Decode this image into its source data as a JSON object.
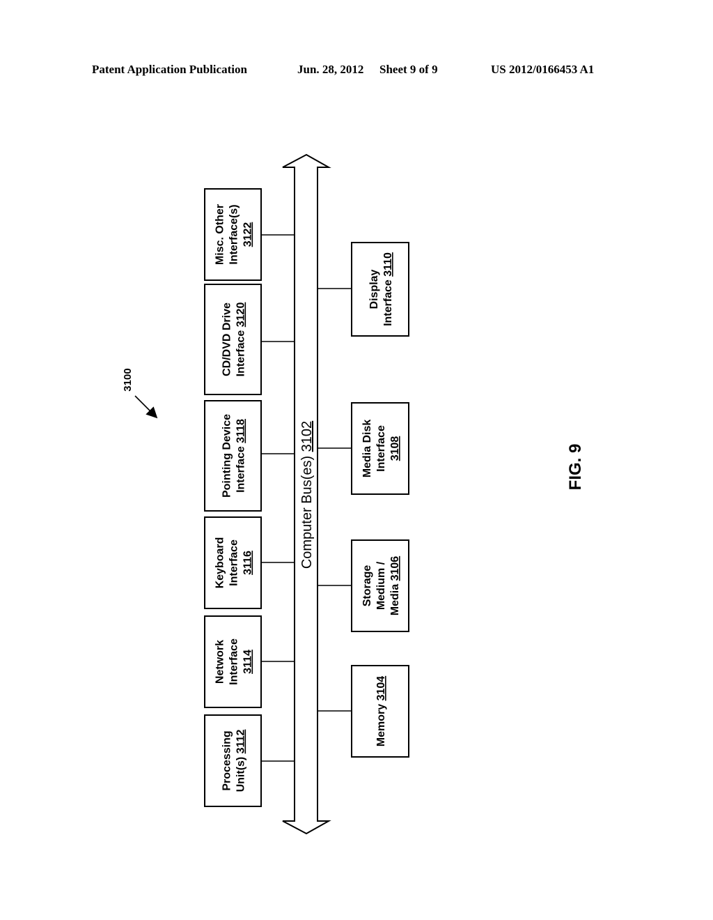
{
  "header": {
    "publication_type": "Patent Application Publication",
    "date": "Jun. 28, 2012",
    "sheet": "Sheet 9 of 9",
    "publication_number": "US 2012/0166453 A1"
  },
  "figure": {
    "label": "FIG. 9",
    "system_ref": "3100",
    "bus": {
      "text": "Computer Bus(es) ",
      "ref": "3102"
    },
    "upper_components": [
      {
        "lines": [
          {
            "text": "Processing",
            "ref": ""
          },
          {
            "text": "Unit(s) ",
            "ref": "3112"
          }
        ]
      },
      {
        "lines": [
          {
            "text": "Network",
            "ref": ""
          },
          {
            "text": "Interface",
            "ref": ""
          },
          {
            "text": "",
            "ref": "3114"
          }
        ]
      },
      {
        "lines": [
          {
            "text": "Keyboard",
            "ref": ""
          },
          {
            "text": "Interface",
            "ref": ""
          },
          {
            "text": "",
            "ref": "3116"
          }
        ]
      },
      {
        "lines": [
          {
            "text": "Pointing Device",
            "ref": ""
          },
          {
            "text": "Interface ",
            "ref": "3118"
          }
        ]
      },
      {
        "lines": [
          {
            "text": "CD/DVD Drive",
            "ref": ""
          },
          {
            "text": "Interface ",
            "ref": "3120"
          }
        ]
      },
      {
        "lines": [
          {
            "text": "Misc. Other",
            "ref": ""
          },
          {
            "text": "Interface(s)",
            "ref": ""
          },
          {
            "text": "",
            "ref": "3122"
          }
        ]
      }
    ],
    "lower_components": [
      {
        "lines": [
          {
            "text": "Memory ",
            "ref": "3104"
          }
        ]
      },
      {
        "lines": [
          {
            "text": "Storage",
            "ref": ""
          },
          {
            "text": "Medium /",
            "ref": ""
          },
          {
            "text": "Media ",
            "ref": "3106"
          }
        ]
      },
      {
        "lines": [
          {
            "text": "Media Disk",
            "ref": ""
          },
          {
            "text": "Interface",
            "ref": ""
          },
          {
            "text": "",
            "ref": "3108"
          }
        ]
      },
      {
        "lines": [
          {
            "text": "Display",
            "ref": ""
          },
          {
            "text": "Interface ",
            "ref": "3110"
          }
        ]
      }
    ]
  }
}
